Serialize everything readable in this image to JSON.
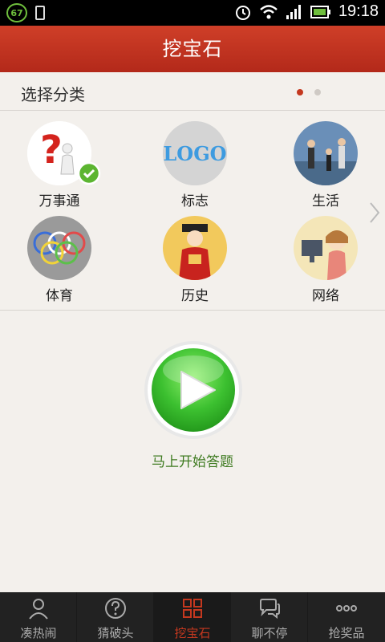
{
  "statusbar": {
    "time": "19:18",
    "badge": "67"
  },
  "title": "挖宝石",
  "category": {
    "header": "选择分类"
  },
  "categories": [
    {
      "label": "万事通",
      "icon": "question-man-icon"
    },
    {
      "label": "标志",
      "icon": "logo-icon"
    },
    {
      "label": "生活",
      "icon": "family-photo-icon"
    },
    {
      "label": "体育",
      "icon": "olympic-rings-icon"
    },
    {
      "label": "历史",
      "icon": "emperor-icon"
    },
    {
      "label": "网络",
      "icon": "computer-girl-icon"
    }
  ],
  "logo_text": "LOGO",
  "start": {
    "label": "马上开始答题"
  },
  "nav": [
    {
      "label": "凑热闹",
      "icon": "person-icon"
    },
    {
      "label": "猜破头",
      "icon": "question-circle-icon"
    },
    {
      "label": "挖宝石",
      "icon": "grid-icon"
    },
    {
      "label": "聊不停",
      "icon": "chat-icon"
    },
    {
      "label": "抢奖品",
      "icon": "more-dots-icon"
    }
  ],
  "colors": {
    "accent": "#c4381f",
    "titlebar": "#c0321f",
    "green": "#3d7a1f"
  }
}
